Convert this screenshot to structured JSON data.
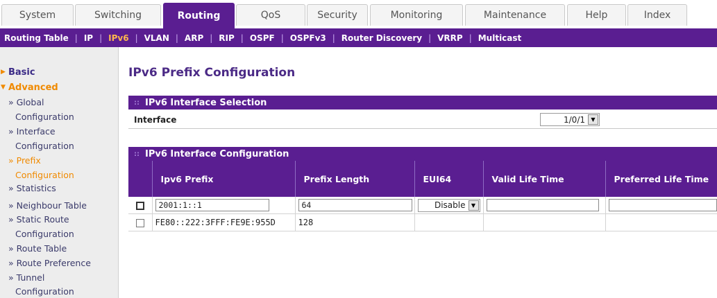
{
  "tabs": [
    "System",
    "Switching",
    "Routing",
    "QoS",
    "Security",
    "Monitoring",
    "Maintenance",
    "Help",
    "Index"
  ],
  "subnav": [
    "Routing Table",
    "IP",
    "IPv6",
    "VLAN",
    "ARP",
    "RIP",
    "OSPF",
    "OSPFv3",
    "Router Discovery",
    "VRRP",
    "Multicast"
  ],
  "sidebar": {
    "basic": "Basic",
    "advanced": "Advanced",
    "items": [
      "» Global",
      "Configuration",
      "» Interface",
      "Configuration",
      "» Prefix",
      "Configuration",
      "» Statistics",
      "» Neighbour Table",
      "» Static Route",
      "Configuration",
      "» Route Table",
      "» Route Preference",
      "» Tunnel",
      "Configuration"
    ]
  },
  "page_title": "IPv6 Prefix Configuration",
  "selection": {
    "header": "IPv6 Interface Selection",
    "interface_label": "Interface",
    "interface_value": "1/0/1"
  },
  "config": {
    "header": "IPv6 Interface Configuration",
    "columns": [
      "Ipv6 Prefix",
      "Prefix Length",
      "EUI64",
      "Valid Life Time",
      "Preferred Life Time"
    ],
    "input_row": {
      "prefix": "2001:1::1",
      "length": "64",
      "eui64": "Disable",
      "valid": "",
      "preferred": ""
    },
    "rows": [
      {
        "prefix": "FE80::222:3FFF:FE9E:955D",
        "length": "128"
      }
    ]
  },
  "colors": {
    "purple": "#5a1e91",
    "orange": "#f08a00",
    "title": "#4b2a86"
  }
}
